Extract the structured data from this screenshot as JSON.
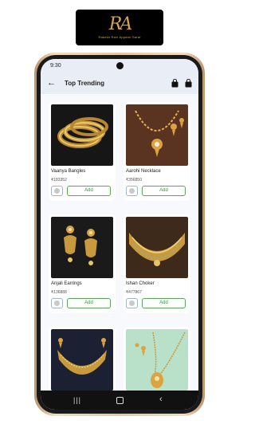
{
  "brand": {
    "monogram": "RA",
    "name": "Rakesh Ravi Apparel Saraf"
  },
  "status_bar": {
    "time": "9:30"
  },
  "app_bar": {
    "title": "Top Trending",
    "back_icon": "arrow-left-icon",
    "actions": [
      "shopping-bag-icon",
      "shopping-bag-icon"
    ]
  },
  "products": [
    {
      "name": "Vaanya Bangles",
      "price": "₹183352",
      "add_label": "Add"
    },
    {
      "name": "Aarohi Necklace",
      "price": "₹356850",
      "add_label": "Add"
    },
    {
      "name": "Anjali Earrings",
      "price": "₹136888",
      "add_label": "Add"
    },
    {
      "name": "Ishan Choker",
      "price": "₹477867",
      "add_label": "Add"
    },
    {
      "name": "",
      "price": "",
      "add_label": ""
    },
    {
      "name": "",
      "price": "",
      "add_label": ""
    }
  ],
  "nav_bar": {
    "items": [
      "recent-apps-icon",
      "home-icon",
      "back-icon"
    ]
  },
  "colors": {
    "accent_green": "#58a858",
    "appbar": "#e9edf5",
    "frame_gold": "#e3c7a3"
  }
}
